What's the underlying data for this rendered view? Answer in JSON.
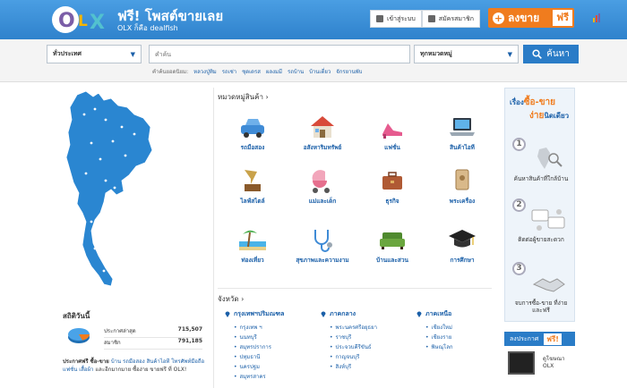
{
  "header": {
    "tagline": "ฟรี! โพสต์ขายเลย",
    "tagline_sub": "OLX ก็คือ dealfish",
    "login_label": "เข้าสู่ระบบ",
    "register_label": "สมัครสมาชิก",
    "post_label": "ลงขาย",
    "post_badge": "ฟรี"
  },
  "search": {
    "location_value": "ทั่วประเทศ",
    "query_placeholder": "คำค้น",
    "category_value": "ทุกหมวดหมู่",
    "button_label": "ค้นหา",
    "popular_label": "คำค้นยอดนิยม:",
    "popular_terms": [
      "หลวงปู่ทิม",
      "รถเช่า",
      "ชุดเดรส",
      "ผลงมมี",
      "รถบ้าน",
      "บ้านเดี่ยว",
      "จักรยานพับ"
    ]
  },
  "categories": {
    "title": "หมวดหมู่สินค้า",
    "items": [
      {
        "label": "รถมือสอง",
        "icon": "car-icon"
      },
      {
        "label": "อสังหาริมทรัพย์",
        "icon": "house-icon"
      },
      {
        "label": "แฟชั่น",
        "icon": "high-heel-icon"
      },
      {
        "label": "สินค้าไอที",
        "icon": "laptop-icon"
      },
      {
        "label": "ไลฟ์สไตล์",
        "icon": "gramophone-icon"
      },
      {
        "label": "แม่และเด็ก",
        "icon": "stroller-icon"
      },
      {
        "label": "ธุรกิจ",
        "icon": "briefcase-icon"
      },
      {
        "label": "พระเครื่อง",
        "icon": "amulet-icon"
      },
      {
        "label": "ท่องเที่ยว",
        "icon": "beach-icon"
      },
      {
        "label": "สุขภาพและความงาม",
        "icon": "stethoscope-icon"
      },
      {
        "label": "บ้านและสวน",
        "icon": "sofa-icon"
      },
      {
        "label": "การศึกษา",
        "icon": "graduation-cap-icon"
      }
    ]
  },
  "provinces": {
    "title": "จังหวัด",
    "regions": [
      {
        "name": "กรุงเทพฯปริมณฑล",
        "items": [
          "กรุงเทพ ฯ",
          "นนทบุรี",
          "สมุทรปราการ",
          "ปทุมธานี",
          "นครปฐม",
          "สมุทรสาคร"
        ]
      },
      {
        "name": "ภาคกลาง",
        "items": [
          "พระนครศรีอยุธยา",
          "ราชบุรี",
          "ประจวบคีรีขันธ์",
          "กาญจนบุรี",
          "สิงห์บุรี"
        ]
      },
      {
        "name": "ภาคเหนือ",
        "items": [
          "เชียงใหม่",
          "เชียงราย",
          "พิษณุโลก"
        ]
      }
    ]
  },
  "stats": {
    "title": "สถิติวันนี้",
    "rows": [
      {
        "label": "ประกาศล่าสุด",
        "value": "715,507"
      },
      {
        "label": "สมาชิก",
        "value": "791,185"
      }
    ]
  },
  "about": {
    "prefix": "ประกาศฟรี ซื้อ-ขาย ",
    "links": "บ้าน รถมือสอง สินค้าไอที โทรศัพท์มือถือ แฟชั่น เสื้อผ้า",
    "suffix": " และอีกมากมาย ซื้อง่าย ขายฟรี ที่ OLX!"
  },
  "howto": {
    "title_pre": "เรื่อง",
    "title_mid": "ซื้อ-ขาย",
    "title_line2": "ง่าย",
    "title_post": "นิดเดียว",
    "steps": [
      {
        "num": "1",
        "caption": "ค้นหาสินค้าที่ใกล้บ้าน"
      },
      {
        "num": "2",
        "caption": "ติดต่อผู้ขายสะดวก"
      },
      {
        "num": "3",
        "caption": "จบการซื้อ-ขาย ที่ง่ายและฟรี"
      }
    ]
  },
  "promo": {
    "label": "ลงประกาศ",
    "badge": "ฟรี!"
  },
  "tv": {
    "caption_line1": "ดูโฆษณา",
    "caption_line2": "OLX"
  },
  "colors": {
    "brand_blue": "#2a7cc7",
    "accent_orange": "#f07c1e"
  }
}
